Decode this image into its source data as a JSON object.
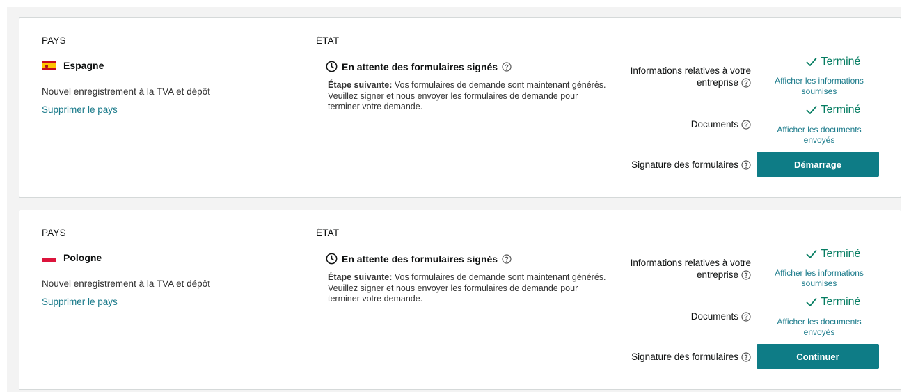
{
  "cards": [
    {
      "country_header": "PAYS",
      "country_name": "Espagne",
      "flag_icon": "spain-flag",
      "registration_type": "Nouvel enregistrement à la TVA et dépôt",
      "remove_link": "Supprimer le pays",
      "status_header": "ÉTAT",
      "status_title": "En attente des formulaires signés",
      "next_step_label": "Étape suivante:",
      "next_step_text": " Vos formulaires de demande sont maintenant générés. Veuillez signer et nous envoyer les formulaires de demande pour terminer votre demande.",
      "requirements": {
        "business_info_label": "Informations relatives à votre entreprise",
        "business_info_status": "Terminé",
        "business_info_link": "Afficher les informations soumises",
        "documents_label": "Documents",
        "documents_status": "Terminé",
        "documents_link": "Afficher les documents envoyés",
        "signature_label": "Signature des formulaires",
        "signature_button": "Démarrage"
      }
    },
    {
      "country_header": "PAYS",
      "country_name": "Pologne",
      "flag_icon": "poland-flag",
      "registration_type": "Nouvel enregistrement à la TVA et dépôt",
      "remove_link": "Supprimer le pays",
      "status_header": "ÉTAT",
      "status_title": "En attente des formulaires signés",
      "next_step_label": "Étape suivante:",
      "next_step_text": " Vos formulaires de demande sont maintenant générés. Veuillez signer et nous envoyer les formulaires de demande pour terminer votre demande.",
      "requirements": {
        "business_info_label": "Informations relatives à votre entreprise",
        "business_info_status": "Terminé",
        "business_info_link": "Afficher les informations soumises",
        "documents_label": "Documents",
        "documents_status": "Terminé",
        "documents_link": "Afficher les documents envoyés",
        "signature_label": "Signature des formulaires",
        "signature_button": "Continuer"
      }
    }
  ],
  "colors": {
    "accent_teal": "#0e7c86",
    "link_teal": "#1a7a8a",
    "success_green": "#067d62",
    "card_border": "#d5d9d9"
  }
}
